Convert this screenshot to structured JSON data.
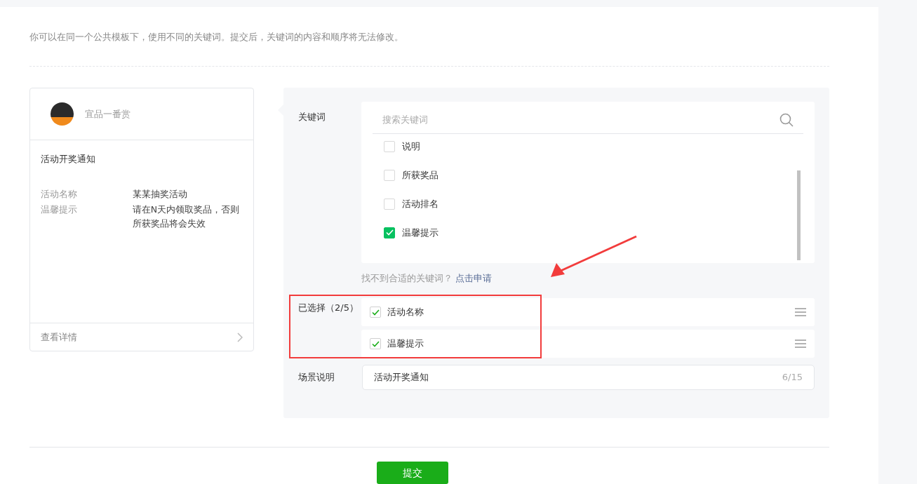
{
  "intro": "你可以在同一个公共模板下，使用不同的关键词。提交后，关键词的内容和顺序将无法修改。",
  "preview": {
    "account": "宜品一番赏",
    "title": "活动开奖通知",
    "fields": [
      {
        "label": "活动名称",
        "value": "某某抽奖活动"
      },
      {
        "label": "温馨提示",
        "value": "请在N天内领取奖品，否则所获奖品将会失效"
      }
    ],
    "footer_link": "查看详情"
  },
  "form": {
    "keywords_label": "关键词",
    "search": {
      "placeholder": "搜索关键词"
    },
    "options": [
      {
        "label": "说明",
        "checked": false
      },
      {
        "label": "所获奖品",
        "checked": false
      },
      {
        "label": "活动排名",
        "checked": false
      },
      {
        "label": "温馨提示",
        "checked": true
      }
    ],
    "hint": "找不到合适的关键词？",
    "apply_link": "点击申请",
    "selected_label": "已选择（2/5）",
    "selected": [
      {
        "label": "活动名称",
        "checked": true
      },
      {
        "label": "温馨提示",
        "checked": true
      }
    ],
    "scene_label": "场景说明",
    "scene": {
      "value": "活动开奖通知",
      "count": "6/15"
    }
  },
  "submit": "提交"
}
